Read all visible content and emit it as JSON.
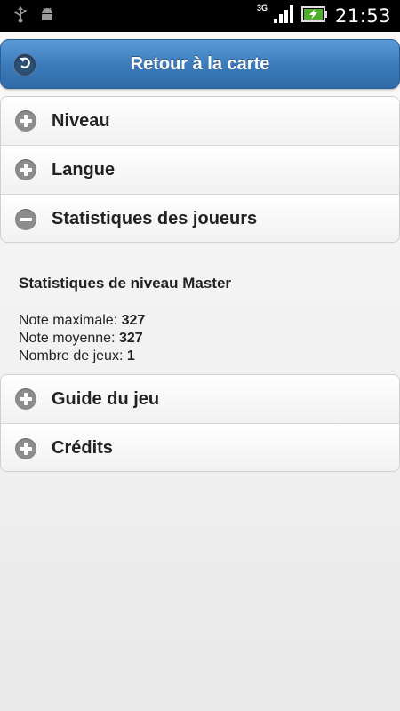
{
  "status_bar": {
    "network": "3G",
    "time": "21:53",
    "icons": [
      "usb-icon",
      "android-icon",
      "signal-icon",
      "battery-charging-icon"
    ]
  },
  "header": {
    "title": "Retour à la carte",
    "back_icon": "back-arrow-icon"
  },
  "menu_top": [
    {
      "label": "Niveau",
      "state": "collapsed"
    },
    {
      "label": "Langue",
      "state": "collapsed"
    },
    {
      "label": "Statistiques des joueurs",
      "state": "expanded"
    }
  ],
  "stats": {
    "title": "Statistiques de niveau Master",
    "max_label": "Note maximale:",
    "max_value": "327",
    "avg_label": "Note moyenne:",
    "avg_value": "327",
    "games_label": "Nombre de jeux:",
    "games_value": "1"
  },
  "menu_bottom": [
    {
      "label": "Guide du jeu",
      "state": "collapsed"
    },
    {
      "label": "Crédits",
      "state": "collapsed"
    }
  ],
  "colors": {
    "header": "#3b7ab9",
    "icon": "#8c8c8c",
    "background": "#f0f0f0"
  }
}
